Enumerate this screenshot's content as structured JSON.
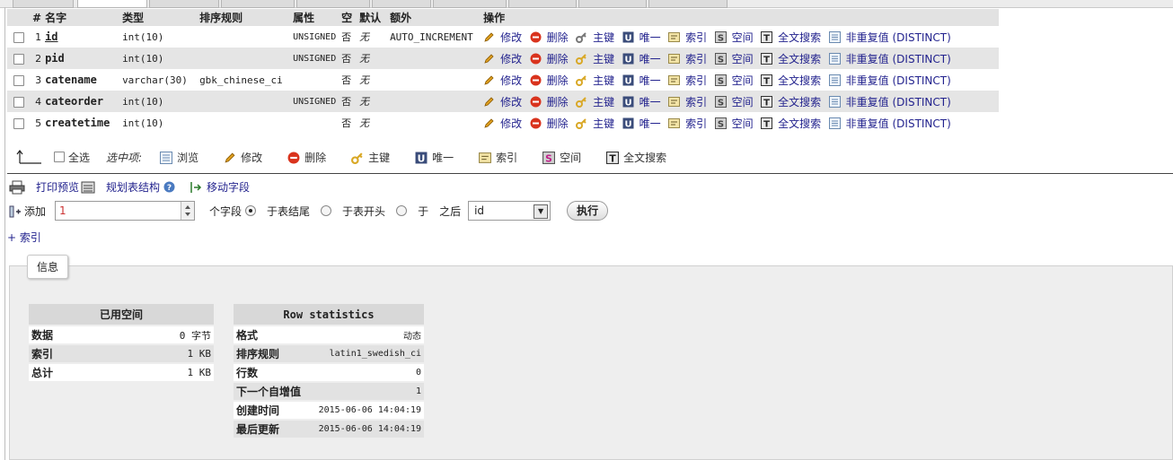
{
  "table": {
    "headers": [
      "#",
      "名字",
      "类型",
      "排序规则",
      "属性",
      "空",
      "默认",
      "额外",
      "操作"
    ],
    "rows": [
      {
        "num": "1",
        "name": "id",
        "type": "int(10)",
        "collation": "",
        "attributes": "UNSIGNED",
        "null": "否",
        "default": "无",
        "extra": "AUTO_INCREMENT",
        "primary_icon": "key-gray"
      },
      {
        "num": "2",
        "name": "pid",
        "type": "int(10)",
        "collation": "",
        "attributes": "UNSIGNED",
        "null": "否",
        "default": "无",
        "extra": "",
        "primary_icon": "key-gold"
      },
      {
        "num": "3",
        "name": "catename",
        "type": "varchar(30)",
        "collation": "gbk_chinese_ci",
        "attributes": "",
        "null": "否",
        "default": "无",
        "extra": "",
        "primary_icon": "key-gold"
      },
      {
        "num": "4",
        "name": "cateorder",
        "type": "int(10)",
        "collation": "",
        "attributes": "UNSIGNED",
        "null": "否",
        "default": "无",
        "extra": "",
        "primary_icon": "key-gold"
      },
      {
        "num": "5",
        "name": "createtime",
        "type": "int(10)",
        "collation": "",
        "attributes": "",
        "null": "否",
        "default": "无",
        "extra": "",
        "primary_icon": "key-gold"
      }
    ],
    "actions": {
      "edit": "修改",
      "drop": "删除",
      "primary": "主键",
      "unique": "唯一",
      "index": "索引",
      "spatial": "空间",
      "fulltext": "全文搜索",
      "distinct": "非重复值 (DISTINCT)"
    }
  },
  "bulk": {
    "check_all": "全选",
    "with_selected": "选中项:",
    "browse": "浏览",
    "edit": "修改",
    "drop": "删除",
    "primary": "主键",
    "unique": "唯一",
    "index": "索引",
    "spatial": "空间",
    "fulltext": "全文搜索"
  },
  "links": {
    "print_view": "打印预览",
    "propose_structure": "规划表结构",
    "move_columns": "移动字段"
  },
  "add_column": {
    "label": "添加",
    "count": "1",
    "unit": "个字段",
    "opt_end": "于表结尾",
    "opt_begin": "于表开头",
    "opt_after_prefix": "于",
    "opt_after_suffix": "之后",
    "after_field": "id",
    "go": "执行"
  },
  "index_link": "+ 索引",
  "info": {
    "legend": "信息",
    "space": {
      "title": "已用空间",
      "rows": [
        {
          "k": "数据",
          "v": "0 字节"
        },
        {
          "k": "索引",
          "v": "1 KB"
        },
        {
          "k": "总计",
          "v": "1 KB"
        }
      ]
    },
    "rowstats": {
      "title": "Row statistics",
      "rows": [
        {
          "k": "格式",
          "v": "动态"
        },
        {
          "k": "排序规则",
          "v": "latin1_swedish_ci"
        },
        {
          "k": "行数",
          "v": "0"
        },
        {
          "k": "下一个自增值",
          "v": "1"
        },
        {
          "k": "创建时间",
          "v": "2015-06-06 14:04:19"
        },
        {
          "k": "最后更新",
          "v": "2015-06-06 14:04:19"
        }
      ]
    }
  },
  "colors": {
    "link": "#23238e",
    "header_bg": "#e2e2e2",
    "row_alt_bg": "#e5e5e5",
    "panel_bg": "#eeeeee",
    "drop_icon": "#d9331d",
    "edit_icon": "#e0a020",
    "key_gold": "#d9a826"
  }
}
